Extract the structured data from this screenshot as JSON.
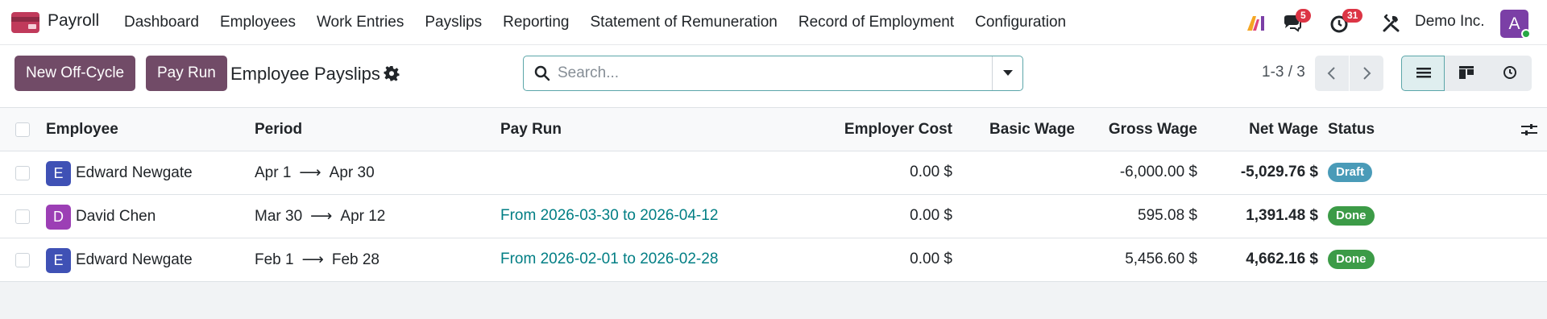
{
  "navbar": {
    "app_name": "Payroll",
    "menu": [
      "Dashboard",
      "Employees",
      "Work Entries",
      "Payslips",
      "Reporting",
      "Statement of Remuneration",
      "Record of Employment",
      "Configuration"
    ],
    "messages_count": "5",
    "activities_count": "31",
    "company": "Demo Inc.",
    "user_initial": "A"
  },
  "control": {
    "new_off_cycle": "New Off-Cycle",
    "pay_run": "Pay Run",
    "title": "Employee Payslips",
    "search_placeholder": "Search...",
    "pager": "1-3 / 3"
  },
  "table": {
    "headers": {
      "employee": "Employee",
      "period": "Period",
      "pay_run": "Pay Run",
      "employer_cost": "Employer Cost",
      "basic_wage": "Basic Wage",
      "gross_wage": "Gross Wage",
      "net_wage": "Net Wage",
      "status": "Status"
    },
    "rows": [
      {
        "initial": "E",
        "avatar_color": "#3f51b5",
        "employee": "Edward Newgate",
        "period_start": "Apr 1",
        "period_end": "Apr 30",
        "pay_run": "",
        "employer_cost": "0.00 $",
        "basic_wage": "",
        "gross_wage": "-6,000.00 $",
        "net_wage": "-5,029.76 $",
        "status": "Draft",
        "status_color": "#4a9bb8"
      },
      {
        "initial": "D",
        "avatar_color": "#9c3fb5",
        "employee": "David Chen",
        "period_start": "Mar 30",
        "period_end": "Apr 12",
        "pay_run": "From 2026-03-30 to 2026-04-12",
        "employer_cost": "0.00 $",
        "basic_wage": "",
        "gross_wage": "595.08 $",
        "net_wage": "1,391.48 $",
        "status": "Done",
        "status_color": "#3c9b47"
      },
      {
        "initial": "E",
        "avatar_color": "#3f51b5",
        "employee": "Edward Newgate",
        "period_start": "Feb 1",
        "period_end": "Feb 28",
        "pay_run": "From 2026-02-01 to 2026-02-28",
        "employer_cost": "0.00 $",
        "basic_wage": "",
        "gross_wage": "5,456.60 $",
        "net_wage": "4,662.16 $",
        "status": "Done",
        "status_color": "#3c9b47"
      }
    ]
  }
}
